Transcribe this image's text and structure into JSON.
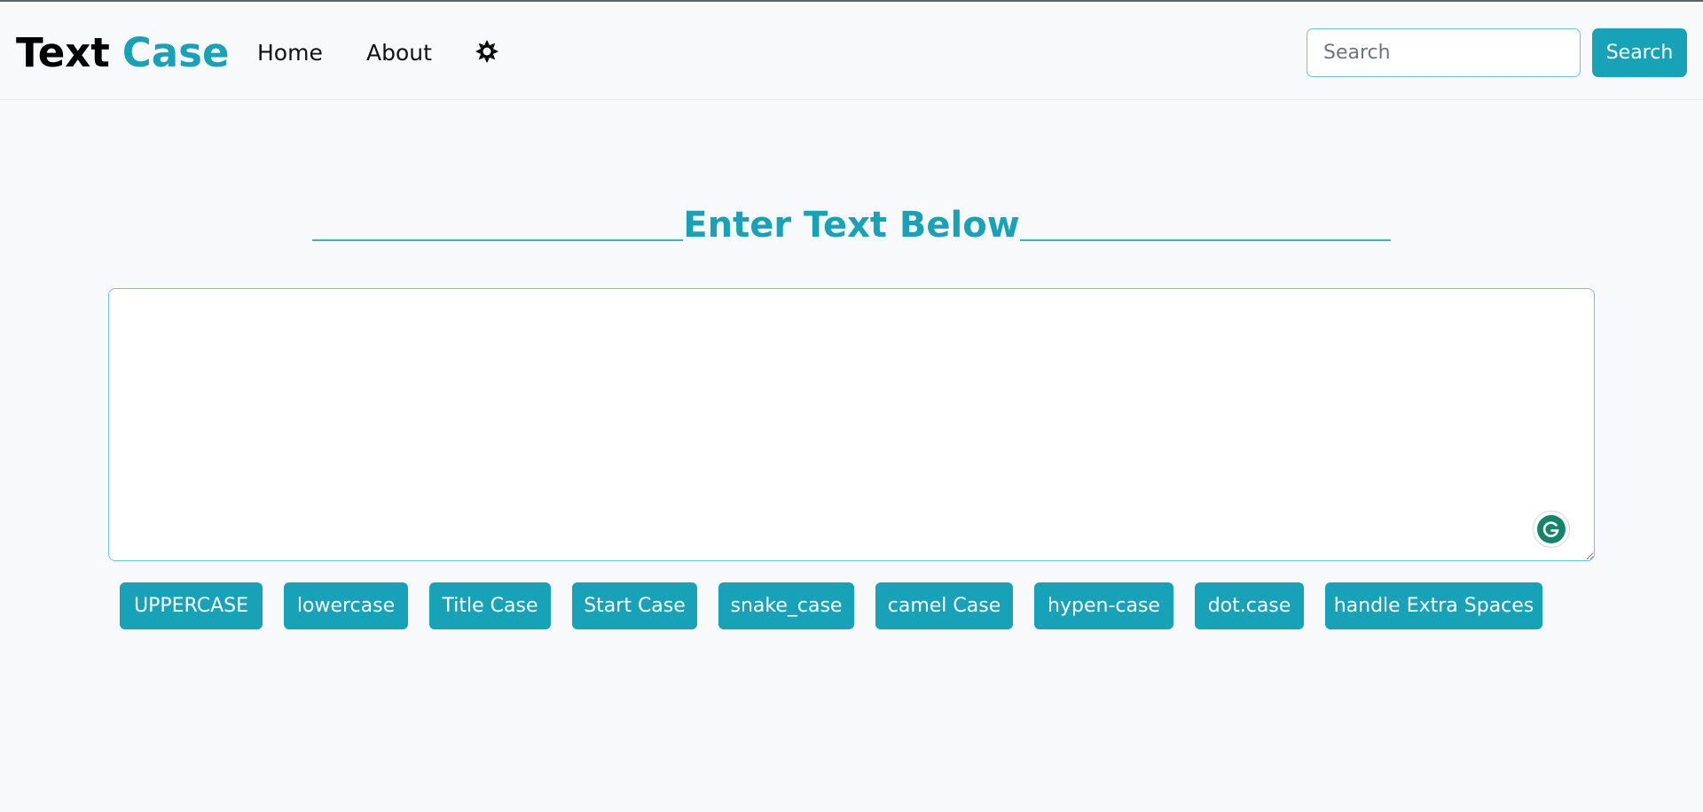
{
  "brand": {
    "part1": "Text",
    "part2": "Case"
  },
  "nav": {
    "home": "Home",
    "about": "About"
  },
  "theme_toggle_icon": "sun-icon",
  "search": {
    "placeholder": "Search",
    "button_label": "Search"
  },
  "main": {
    "heading": "Enter Text Below",
    "textarea_value": ""
  },
  "grammarly_icon": "grammarly-icon",
  "case_buttons": [
    "UPPERCASE",
    "lowercase",
    "Title Case",
    "Start Case",
    "snake_case",
    "camel Case",
    "hypen-case",
    "dot.case",
    "handle Extra Spaces"
  ],
  "colors": {
    "accent": "#17a2b8",
    "background": "#f8f9fa",
    "border": "#6cc7d4"
  }
}
